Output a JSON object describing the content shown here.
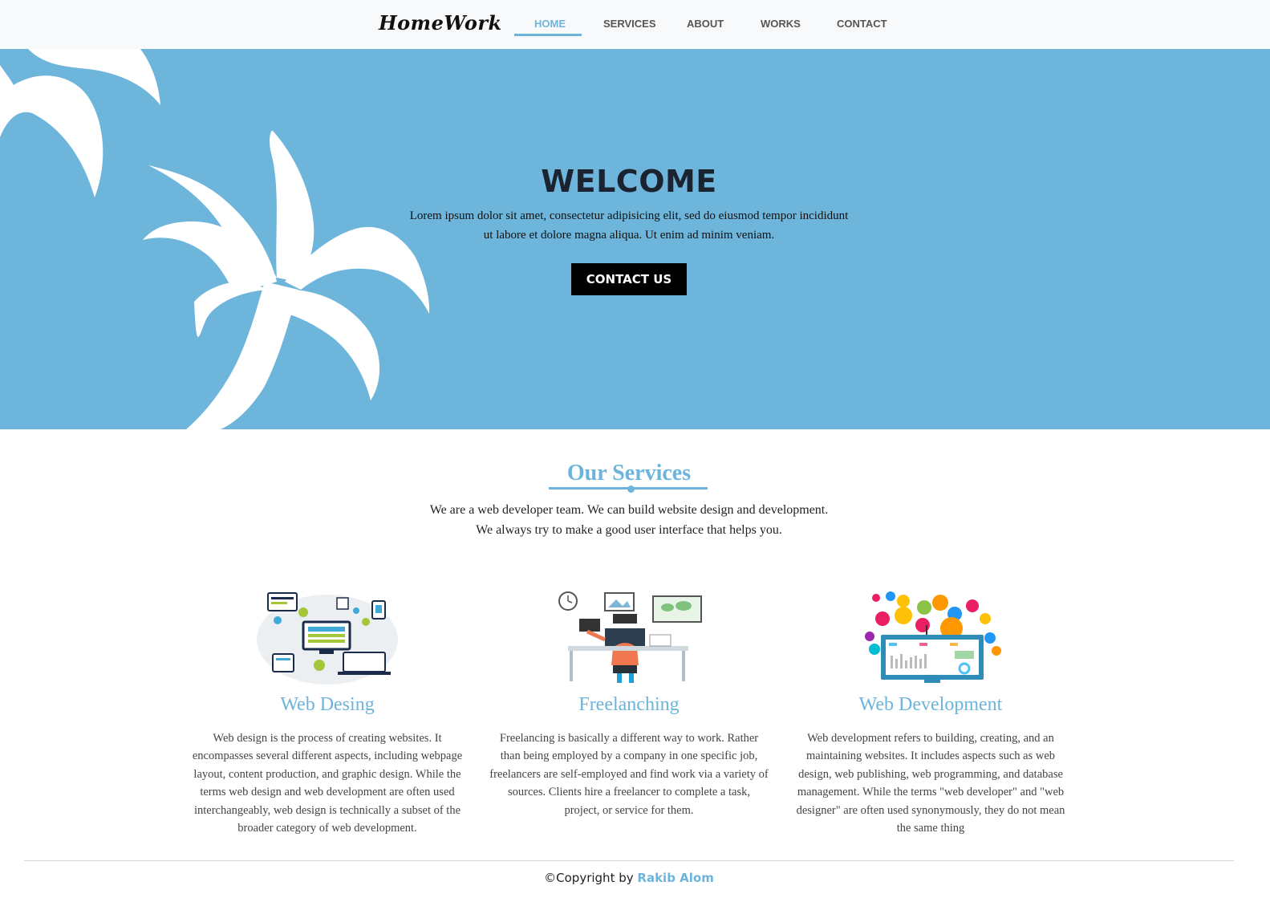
{
  "nav": {
    "logo": "HomeWork",
    "items": [
      {
        "label": "HOME",
        "active": true
      },
      {
        "label": "SERVICES",
        "active": false
      },
      {
        "label": "ABOUT",
        "active": false
      },
      {
        "label": "WORKS",
        "active": false
      },
      {
        "label": "CONTACT",
        "active": false
      }
    ]
  },
  "hero": {
    "title": "WELCOME",
    "text": "Lorem ipsum dolor sit amet, consectetur adipisicing elit, sed do eiusmod tempor incididunt ut labore et dolore magna aliqua. Ut enim ad minim veniam.",
    "button": "CONTACT US"
  },
  "services": {
    "title": "Our Services",
    "intro_line1": "We are a web developer team. We can build website design and development.",
    "intro_line2": "We always try to make a good user interface that helps you.",
    "cards": [
      {
        "title": "Web Desing",
        "icon": "network-devices-illustration",
        "text": "Web design is the process of creating websites. It encompasses several different aspects, including webpage layout, content production, and graphic design. While the terms web design and web development are often used interchangeably, web design is technically a subset of the broader category of web development."
      },
      {
        "title": "Freelanching",
        "icon": "person-at-desk-illustration",
        "text": "Freelancing is basically a different way to work. Rather than being employed by a company in one specific job, freelancers are self-employed and find work via a variety of sources. Clients hire a freelancer to complete a task, project, or service for them."
      },
      {
        "title": "Web Development",
        "icon": "monitor-tech-bubbles-illustration",
        "text": "Web development refers to building, creating, and an maintaining websites. It includes aspects such as web design, web publishing, web programming, and database management. While the terms \"web developer\" and \"web designer\" are often used synonymously, they do not mean the same thing"
      }
    ]
  },
  "footer": {
    "copyright": "©Copyright by",
    "author": "Rakib Alom"
  },
  "colors": {
    "accent": "#6cb4dc",
    "hero_bg": "#6eb5dc",
    "nav_bg": "#f8f9fa"
  }
}
